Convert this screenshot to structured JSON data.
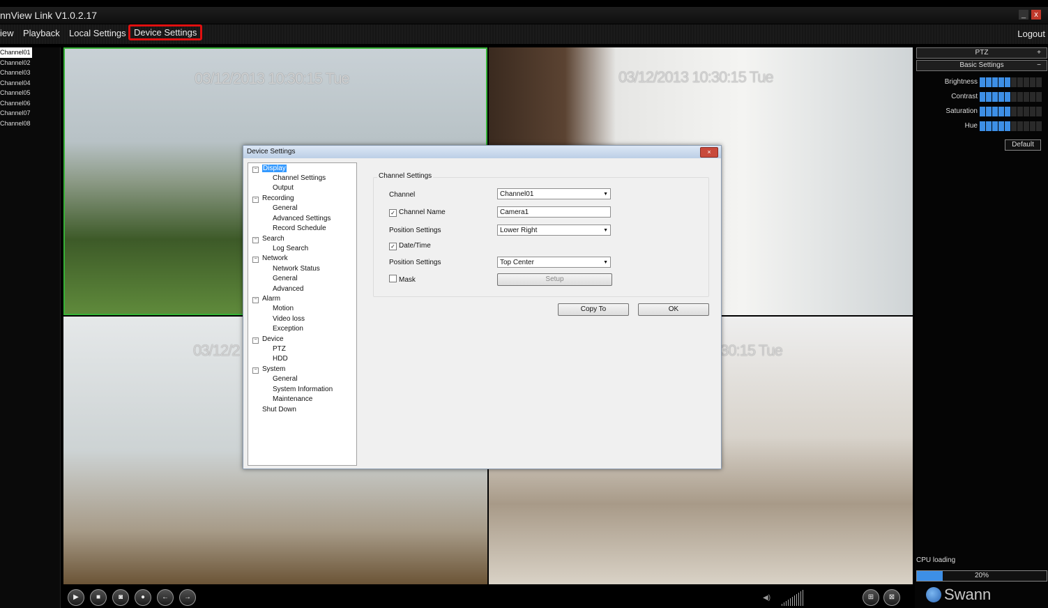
{
  "app": {
    "title": "nnView Link V1.0.2.17"
  },
  "menu": {
    "items": [
      "iew",
      "Playback",
      "Local Settings",
      "Device Settings"
    ],
    "active": "Device Settings",
    "logout": "Logout"
  },
  "channels": [
    "Channel01",
    "Channel02",
    "Channel03",
    "Channel04",
    "Channel05",
    "Channel06",
    "Channel07",
    "Channel08"
  ],
  "cameras": {
    "c1_timestamp": "03/12/2013 10:30:15 Tue",
    "c2_timestamp": "03/12/2013 10:30:15 Tue",
    "c3_timestamp": "03/12/2",
    "c4_timestamp": "30:15 Tue"
  },
  "dialog": {
    "title": "Device Settings",
    "close": "×",
    "tree": {
      "display": "Display",
      "channel_settings": "Channel Settings",
      "output": "Output",
      "recording": "Recording",
      "rec_general": "General",
      "advanced_settings": "Advanced Settings",
      "record_schedule": "Record Schedule",
      "search": "Search",
      "log_search": "Log Search",
      "network": "Network",
      "network_status": "Network Status",
      "net_general": "General",
      "net_advanced": "Advanced",
      "alarm": "Alarm",
      "motion": "Motion",
      "video_loss": "Video loss",
      "exception": "Exception",
      "device": "Device",
      "ptz": "PTZ",
      "hdd": "HDD",
      "system": "System",
      "sys_general": "General",
      "system_information": "System Information",
      "maintenance": "Maintenance",
      "shut_down": "Shut Down"
    },
    "form": {
      "section_title": "Channel Settings",
      "channel_label": "Channel",
      "channel_value": "Channel01",
      "channel_name_label": "Channel Name",
      "channel_name_checked": true,
      "channel_name_value": "Camera1",
      "position_label_1": "Position Settings",
      "position_value_1": "Lower Right",
      "datetime_label": "Date/Time",
      "datetime_checked": true,
      "position_label_2": "Position Settings",
      "position_value_2": "Top Center",
      "mask_label": "Mask",
      "mask_checked": false,
      "setup_button": "Setup",
      "copy_to_button": "Copy To",
      "ok_button": "OK"
    }
  },
  "right_panel": {
    "ptz_label": "PTZ",
    "ptz_symbol": "+",
    "basic_settings_label": "Basic Settings",
    "basic_symbol": "−",
    "sliders": [
      {
        "name": "Brightness",
        "level": 5,
        "max": 10
      },
      {
        "name": "Contrast",
        "level": 5,
        "max": 10
      },
      {
        "name": "Saturation",
        "level": 5,
        "max": 10
      },
      {
        "name": "Hue",
        "level": 5,
        "max": 10
      }
    ],
    "default_button": "Default",
    "cpu_label": "CPU loading",
    "cpu_percent": 20,
    "cpu_text": "20%",
    "logo_text": "Swann"
  },
  "colors": {
    "accent": "#3d8fe6",
    "highlight_red": "#e01010",
    "selected_border": "#36b336"
  }
}
